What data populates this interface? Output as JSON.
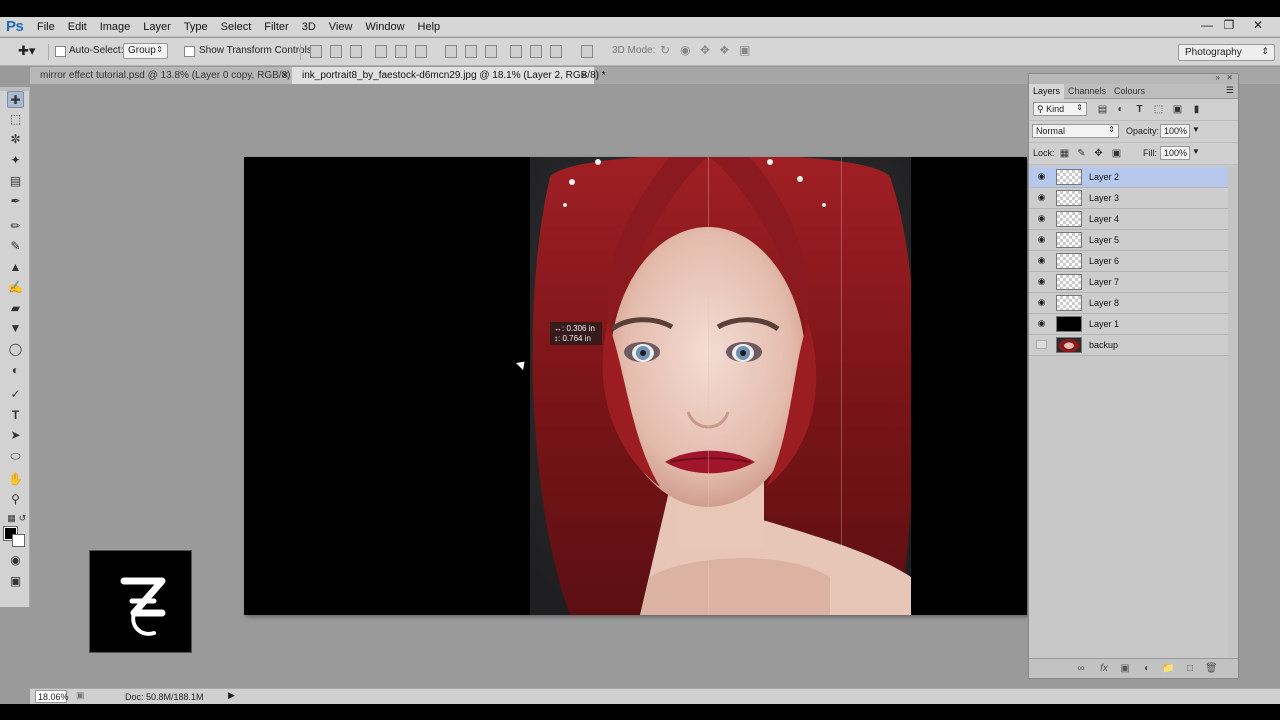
{
  "app": {
    "logo": "Ps",
    "menu": [
      "File",
      "Edit",
      "Image",
      "Layer",
      "Type",
      "Select",
      "Filter",
      "3D",
      "View",
      "Window",
      "Help"
    ],
    "workspace": "Photography"
  },
  "options_bar": {
    "auto_select_label": "Auto-Select:",
    "auto_select_checked": false,
    "auto_select_value": "Group",
    "transform_label": "Show Transform Controls",
    "transform_checked": false,
    "mode_label": "3D Mode:"
  },
  "tabs": [
    {
      "label": "mirror effect tutorial.psd @ 13.8% (Layer 0 copy, RGB/8)",
      "active": false
    },
    {
      "label": "ink_portrait8_by_faestock-d6mcn29.jpg @ 18.1% (Layer 2, RGB/8) *",
      "active": true
    }
  ],
  "canvas": {
    "measure_w": "0.306 in",
    "measure_h": "0.764 in"
  },
  "status": {
    "zoom": "18.06%",
    "doc": "Doc: 50.8M/188.1M"
  },
  "layers_panel": {
    "tabs": [
      "Layers",
      "Channels",
      "Colours"
    ],
    "kind_label": "Kind",
    "blend_mode": "Normal",
    "opacity_label": "Opacity:",
    "opacity_value": "100%",
    "lock_label": "Lock:",
    "fill_label": "Fill:",
    "fill_value": "100%",
    "layers": [
      {
        "name": "Layer 2",
        "visible": true,
        "selected": true,
        "thumb": "checker"
      },
      {
        "name": "Layer 3",
        "visible": true,
        "selected": false,
        "thumb": "checker"
      },
      {
        "name": "Layer 4",
        "visible": true,
        "selected": false,
        "thumb": "checker"
      },
      {
        "name": "Layer 5",
        "visible": true,
        "selected": false,
        "thumb": "checker"
      },
      {
        "name": "Layer 6",
        "visible": true,
        "selected": false,
        "thumb": "checker"
      },
      {
        "name": "Layer 7",
        "visible": true,
        "selected": false,
        "thumb": "checker"
      },
      {
        "name": "Layer 8",
        "visible": true,
        "selected": false,
        "thumb": "checker"
      },
      {
        "name": "Layer 1",
        "visible": true,
        "selected": false,
        "thumb": "black"
      },
      {
        "name": "backup",
        "visible": false,
        "selected": false,
        "thumb": "photo"
      }
    ]
  },
  "colors": {
    "accent": "#1e6bb8",
    "selection": "#b7c8ef",
    "hair": "#8e1a1f"
  }
}
